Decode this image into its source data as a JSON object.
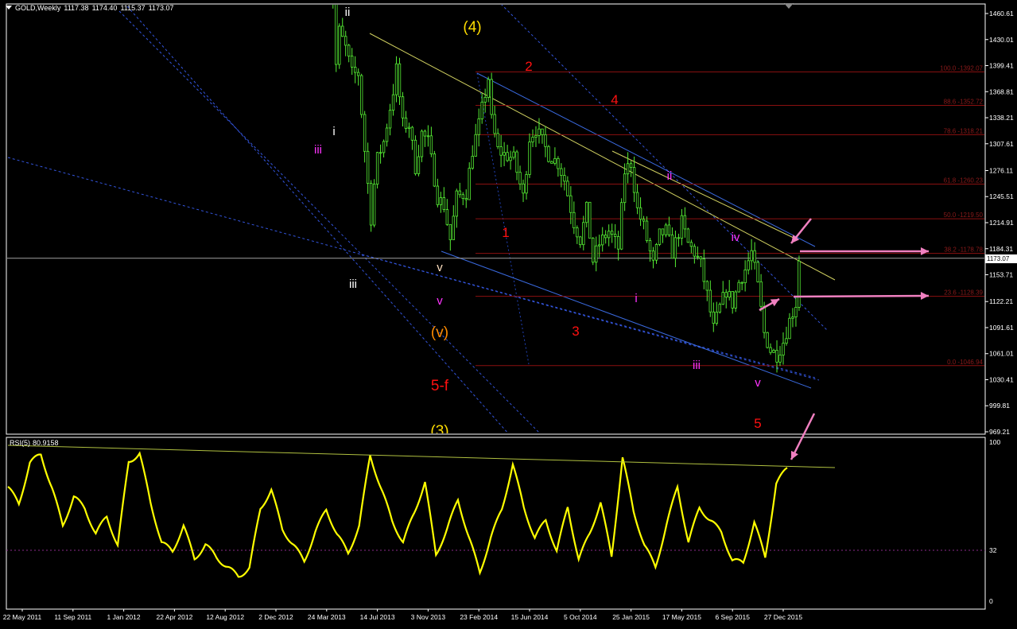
{
  "window": {
    "symbol": "GOLD,Weekly",
    "ohlc": [
      "1117.38",
      "1174.40",
      "1115.37",
      "1173.07"
    ]
  },
  "indicator": {
    "name": "RSI(5)",
    "value": "80.9158"
  },
  "current_price_label": "1173.07",
  "colors": {
    "background": "#000000",
    "frame": "#ffffff",
    "candle": "#55ee33",
    "rsi_line": "#ffff00",
    "fib_line": "#8b1010",
    "fib_text": "#8b1a1a",
    "channel": "#3060d8",
    "trend_yellow": "#d8d860",
    "arrow": "#f080c0"
  },
  "chart_data": [
    {
      "type": "candlestick",
      "title": "GOLD,Weekly",
      "y_ticks": [
        1460.61,
        1430.01,
        1399.41,
        1368.81,
        1338.21,
        1307.61,
        1276.11,
        1245.51,
        1214.91,
        1184.31,
        1153.71,
        1122.21,
        1091.61,
        1061.01,
        1030.41,
        999.81,
        969.21
      ],
      "y_tick_labels": [
        "1460.61",
        "1430.01",
        "1399.41",
        "1368.81",
        "1338.21",
        "1307.61",
        "1276.11",
        "1245.51",
        "1214.91",
        "1184.31",
        "1153.71",
        "1122.21",
        "1091.61",
        "1061.01",
        "1030.41",
        "999.81",
        "969.21"
      ],
      "ylim": [
        964,
        1475
      ],
      "x_tick_labels": [
        "22 May 2011",
        "11 Sep 2011",
        "1 Jan 2012",
        "22 Apr 2012",
        "12 Aug 2012",
        "2 Dec 2012",
        "24 Mar 2013",
        "14 Jul 2013",
        "3 Nov 2013",
        "23 Feb 2014",
        "15 Jun 2014",
        "5 Oct 2014",
        "25 Jan 2015",
        "17 May 2015",
        "6 Sep 2015",
        "27 Dec 2015"
      ],
      "close_trace": [
        [
          "24 Mar 2013",
          1590
        ],
        [
          "31 Mar 2013",
          1560
        ],
        [
          "14 Apr 2013",
          1400
        ],
        [
          "21 Apr 2013",
          1440
        ],
        [
          "5 May 2013",
          1420
        ],
        [
          "19 May 2013",
          1390
        ],
        [
          "2 Jun 2013",
          1390
        ],
        [
          "16 Jun 2013",
          1300
        ],
        [
          "30 Jun 2013",
          1220
        ],
        [
          "7 Jul 2013",
          1260
        ],
        [
          "14 Jul 2013",
          1290
        ],
        [
          "28 Jul 2013",
          1310
        ],
        [
          "18 Aug 2013",
          1370
        ],
        [
          "25 Aug 2013",
          1395
        ],
        [
          "8 Sep 2013",
          1330
        ],
        [
          "22 Sep 2013",
          1330
        ],
        [
          "6 Oct 2013",
          1280
        ],
        [
          "20 Oct 2013",
          1320
        ],
        [
          "3 Nov 2013",
          1310
        ],
        [
          "24 Nov 2013",
          1245
        ],
        [
          "8 Dec 2013",
          1235
        ],
        [
          "22 Dec 2013",
          1195
        ],
        [
          "5 Jan 2014",
          1245
        ],
        [
          "26 Jan 2014",
          1250
        ],
        [
          "9 Feb 2014",
          1300
        ],
        [
          "23 Feb 2014",
          1330
        ],
        [
          "16 Mar 2014",
          1385
        ],
        [
          "23 Mar 2014",
          1335
        ],
        [
          "6 Apr 2014",
          1300
        ],
        [
          "20 Apr 2014",
          1295
        ],
        [
          "11 May 2014",
          1290
        ],
        [
          "1 Jun 2014",
          1245
        ],
        [
          "15 Jun 2014",
          1315
        ],
        [
          "29 Jun 2014",
          1325
        ],
        [
          "13 Jul 2014",
          1310
        ],
        [
          "27 Jul 2014",
          1295
        ],
        [
          "17 Aug 2014",
          1285
        ],
        [
          "31 Aug 2014",
          1265
        ],
        [
          "21 Sep 2014",
          1215
        ],
        [
          "5 Oct 2014",
          1195
        ],
        [
          "19 Oct 2014",
          1230
        ],
        [
          "2 Nov 2014",
          1170
        ],
        [
          "16 Nov 2014",
          1190
        ],
        [
          "7 Dec 2014",
          1205
        ],
        [
          "28 Dec 2014",
          1185
        ],
        [
          "11 Jan 2015",
          1275
        ],
        [
          "25 Jan 2015",
          1285
        ],
        [
          "8 Feb 2015",
          1230
        ],
        [
          "22 Feb 2015",
          1210
        ],
        [
          "15 Mar 2015",
          1165
        ],
        [
          "29 Mar 2015",
          1200
        ],
        [
          "12 Apr 2015",
          1205
        ],
        [
          "26 Apr 2015",
          1180
        ],
        [
          "17 May 2015",
          1215
        ],
        [
          "31 May 2015",
          1190
        ],
        [
          "14 Jun 2015",
          1180
        ],
        [
          "28 Jun 2015",
          1165
        ],
        [
          "12 Jul 2015",
          1130
        ],
        [
          "26 Jul 2015",
          1090
        ],
        [
          "9 Aug 2015",
          1115
        ],
        [
          "23 Aug 2015",
          1135
        ],
        [
          "6 Sep 2015",
          1120
        ],
        [
          "20 Sep 2015",
          1145
        ],
        [
          "4 Oct 2015",
          1160
        ],
        [
          "18 Oct 2015",
          1180
        ],
        [
          "1 Nov 2015",
          1140
        ],
        [
          "15 Nov 2015",
          1085
        ],
        [
          "29 Nov 2015",
          1065
        ],
        [
          "13 Dec 2015",
          1060
        ],
        [
          "27 Dec 2015",
          1075
        ],
        [
          "10 Jan 2016",
          1100
        ],
        [
          "24 Jan 2016",
          1120
        ],
        [
          "31 Jan 2016",
          1173.07
        ]
      ],
      "fibonacci": [
        {
          "label": "100.0 -1392.07",
          "value": 1392.07
        },
        {
          "label": "88.6 -1352.72",
          "value": 1352.72
        },
        {
          "label": "78.6 -1318.21",
          "value": 1318.21
        },
        {
          "label": "61.8 -1260.23",
          "value": 1260.23
        },
        {
          "label": "50.0 -1219.50",
          "value": 1219.5
        },
        {
          "label": "38.2 -1178.78",
          "value": 1178.78
        },
        {
          "label": "23.6 -1128.39",
          "value": 1128.39
        },
        {
          "label": "0.0 -1046.94",
          "value": 1046.94
        }
      ],
      "wave_labels": [
        {
          "text": "ii",
          "color": "#ffffff"
        },
        {
          "text": "(4)",
          "color": "#ffdd00"
        },
        {
          "text": "2",
          "color": "#ff1010"
        },
        {
          "text": "4",
          "color": "#ff1010"
        },
        {
          "text": "i",
          "color": "#ffffff"
        },
        {
          "text": "iii",
          "color": "#ff33ff"
        },
        {
          "text": "ii",
          "color": "#ff33ff"
        },
        {
          "text": "iv",
          "color": "#ff33ff"
        },
        {
          "text": "1",
          "color": "#ff1010"
        },
        {
          "text": "v",
          "color": "#ffe0c0"
        },
        {
          "text": "iii",
          "color": "#ffffff"
        },
        {
          "text": "v",
          "color": "#ff33ff"
        },
        {
          "text": "i",
          "color": "#ff33ff"
        },
        {
          "text": "(v)",
          "color": "#ff8c00"
        },
        {
          "text": "3",
          "color": "#ff1010"
        },
        {
          "text": "iii",
          "color": "#ff33ff"
        },
        {
          "text": "v",
          "color": "#ff33ff"
        },
        {
          "text": "5-f",
          "color": "#ff1010"
        },
        {
          "text": "5",
          "color": "#ff1010"
        },
        {
          "text": "(3)",
          "color": "#ffdd00"
        }
      ]
    },
    {
      "type": "line",
      "title": "RSI(5) 80.9158",
      "series": [
        {
          "name": "RSI(5)",
          "values": [
            72,
            58,
            88,
            95,
            70,
            45,
            68,
            60,
            40,
            52,
            38,
            88,
            90,
            62,
            40,
            30,
            45,
            28,
            38,
            25,
            20,
            18,
            22,
            55,
            70,
            48,
            35,
            22,
            45,
            60,
            40,
            28,
            50,
            93,
            68,
            50,
            40,
            55,
            72,
            30,
            48,
            62,
            38,
            20,
            42,
            55,
            85,
            62,
            40,
            48,
            32,
            62,
            25,
            40,
            64,
            30,
            88,
            55,
            38,
            22,
            45,
            72,
            40,
            58,
            48,
            45,
            28,
            22,
            48,
            30,
            75,
            81
          ]
        }
      ],
      "y_ticks": [
        0,
        32,
        100
      ],
      "y_tick_labels": [
        "0",
        "32",
        "100"
      ],
      "ylim": [
        0,
        100
      ]
    }
  ]
}
